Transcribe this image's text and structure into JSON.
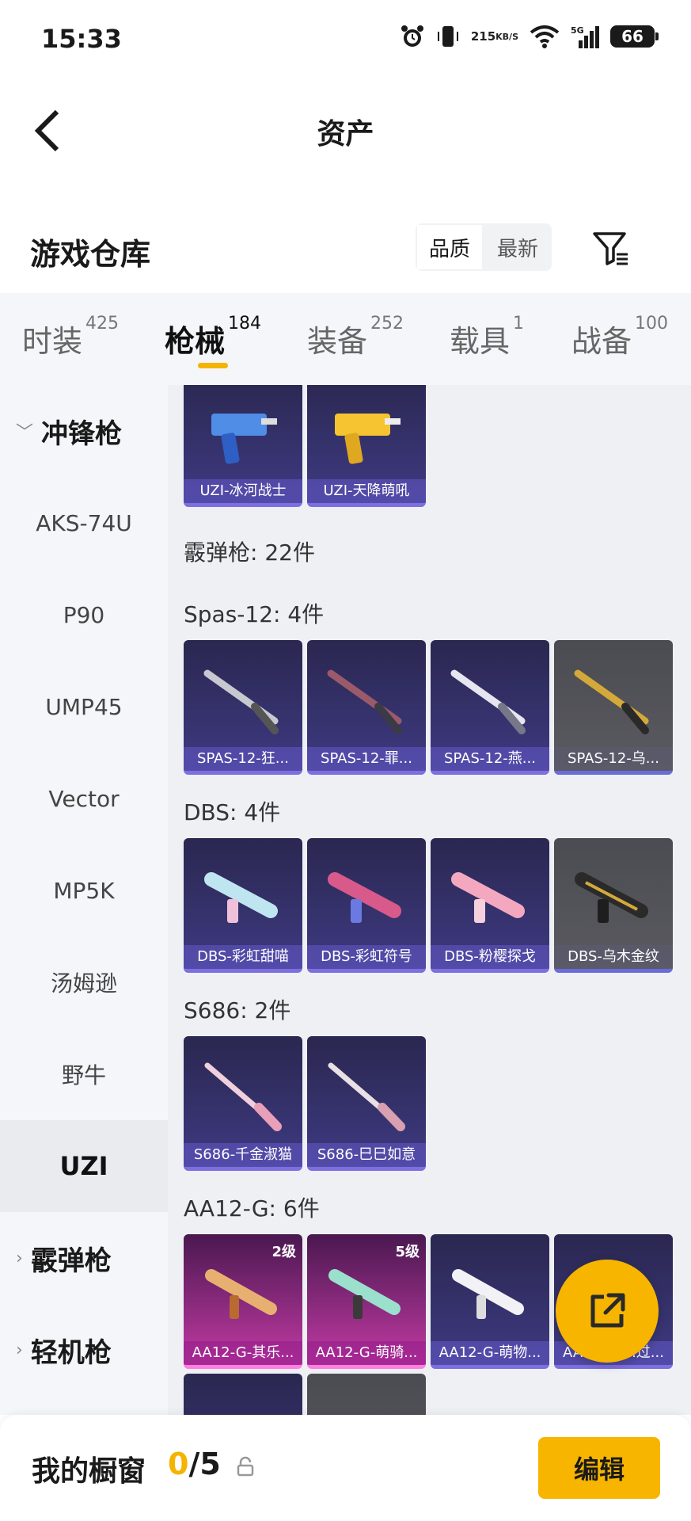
{
  "status_bar": {
    "time": "15:33",
    "speed_value": "215",
    "speed_unit": "KB/S",
    "network": "5G",
    "battery": "66"
  },
  "nav": {
    "title": "资产"
  },
  "header": {
    "title": "游戏仓库",
    "sort_options": [
      "品质",
      "最新"
    ],
    "active_sort": "品质"
  },
  "tabs": [
    {
      "label": "时装",
      "count": "425"
    },
    {
      "label": "枪械",
      "count": "184",
      "active": true
    },
    {
      "label": "装备",
      "count": "252"
    },
    {
      "label": "载具",
      "count": "1"
    },
    {
      "label": "战备",
      "count": "100"
    }
  ],
  "sidebar": {
    "groups": [
      {
        "label": "冲锋枪",
        "expanded": true
      },
      {
        "label": "霰弹枪",
        "expanded": false
      },
      {
        "label": "轻机枪",
        "expanded": false
      }
    ],
    "items": [
      "AKS-74U",
      "P90",
      "UMP45",
      "Vector",
      "MP5K",
      "汤姆逊",
      "野牛",
      "UZI"
    ],
    "active_item": "UZI"
  },
  "content": {
    "uzi_cards": [
      "UZI-冰河战士",
      "UZI-天降萌吼"
    ],
    "shotgun_label": "霰弹枪: 22件",
    "spas_label": "Spas-12: 4件",
    "spas_cards": [
      "SPAS-12-狂...",
      "SPAS-12-罪...",
      "SPAS-12-燕...",
      "SPAS-12-乌..."
    ],
    "dbs_label": "DBS: 4件",
    "dbs_cards": [
      "DBS-彩虹甜喵",
      "DBS-彩虹符号",
      "DBS-粉樱探戈",
      "DBS-乌木金纹"
    ],
    "s686_label": "S686: 2件",
    "s686_cards": [
      "S686-千金淑猫",
      "S686-巳巳如意"
    ],
    "aa12_label": "AA12-G: 6件",
    "aa12_cards": [
      "AA12-G-其乐...",
      "AA12-G-萌骑...",
      "AA12-G-萌物...",
      "AA12-G-...过..."
    ],
    "aa12_levels": [
      "2级",
      "5级"
    ]
  },
  "footer": {
    "title": "我的橱窗",
    "count_current": "0",
    "count_total": "/5",
    "edit_label": "编辑"
  },
  "colors": {
    "accent": "#f7b500",
    "card_purple": "#3e3a82",
    "card_pink": "#c23aa3"
  }
}
